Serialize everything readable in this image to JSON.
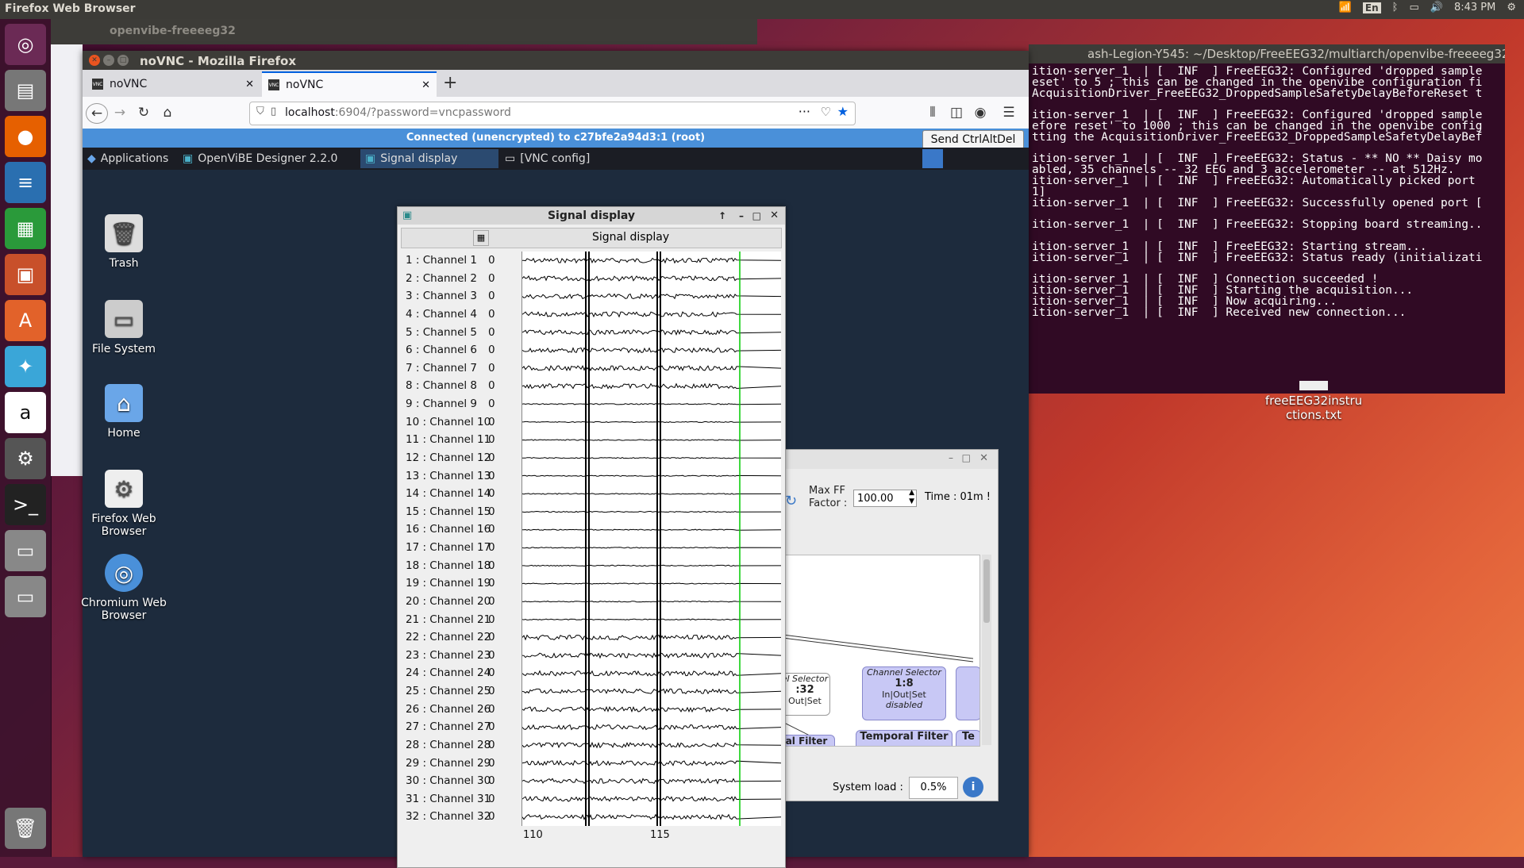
{
  "topbar": {
    "app_title": "Firefox Web Browser",
    "keyboard": "En",
    "time": "8:43 PM"
  },
  "bg_window": {
    "title": "openvibe-freeeeg32"
  },
  "firefox": {
    "title": "noVNC - Mozilla Firefox",
    "tabs": [
      {
        "label": "noVNC",
        "close": "✕"
      },
      {
        "label": "noVNC",
        "close": "✕"
      }
    ],
    "new_tab": "+",
    "url_host": "localhost",
    "url_rest": ":6904/?password=vncpassword",
    "dots": "···"
  },
  "vnc": {
    "status": "Connected (unencrypted) to c27bfe2a94d3:1 (root)",
    "send_cad": "Send CtrlAltDel",
    "panel": {
      "applications": "Applications",
      "tasks": [
        "OpenViBE Designer 2.2.0",
        "Signal display",
        "[VNC config]"
      ]
    },
    "desktop_icons": [
      {
        "label": "Trash",
        "icon": "trash-icon"
      },
      {
        "label": "File System",
        "icon": "drive-icon"
      },
      {
        "label": "Home",
        "icon": "home-folder-icon"
      },
      {
        "label": "Firefox Web Browser",
        "icon": "settings-icon"
      },
      {
        "label": "Chromium Web Browser",
        "icon": "chromium-icon"
      }
    ]
  },
  "signal_display": {
    "title": "Signal display",
    "toolbar_label": "Signal display",
    "channels": [
      "1 : Channel 1",
      "2 : Channel 2",
      "3 : Channel 3",
      "4 : Channel 4",
      "5 : Channel 5",
      "6 : Channel 6",
      "7 : Channel 7",
      "8 : Channel 8",
      "9 : Channel 9",
      "10 : Channel 10",
      "11 : Channel 11",
      "12 : Channel 12",
      "13 : Channel 13",
      "14 : Channel 14",
      "15 : Channel 15",
      "16 : Channel 16",
      "17 : Channel 17",
      "18 : Channel 18",
      "19 : Channel 19",
      "20 : Channel 20",
      "21 : Channel 21",
      "22 : Channel 22",
      "23 : Channel 23",
      "24 : Channel 24",
      "25 : Channel 25",
      "26 : Channel 26",
      "27 : Channel 27",
      "28 : Channel 28",
      "29 : Channel 29",
      "30 : Channel 30",
      "31 : Channel 31",
      "32 : Channel 32"
    ],
    "channel_value": "0",
    "x_ticks": [
      "110",
      "115"
    ]
  },
  "designer": {
    "max_ff_label": "Max FF",
    "factor_label": "Factor :",
    "factor_value": "100.00",
    "time_label": "Time : 01m !",
    "node1_title": "el Selector",
    "node1_value": ":32",
    "node1_ports": "Out|Set",
    "node2_title": "Channel Selector",
    "node2_value": "1:8",
    "node2_ports": "In|Out|Set",
    "node2_status": "disabled",
    "node3": "Temporal Filter",
    "node4": "Te",
    "node5": "al Filter",
    "sysload_label": "System load :",
    "sysload_value": "0.5%"
  },
  "terminal": {
    "title": "ash-Legion-Y545: ~/Desktop/FreeEEG32/multiarch/openvibe-freeeeg32",
    "lines": [
      "ition-server_1  | [  INF  ] FreeEEG32: Configured 'dropped sample",
      "eset' to 5 ; this can be changed in the openvibe configuration fi",
      "AcquisitionDriver_FreeEEG32_DroppedSampleSafetyDelayBeforeReset t",
      "",
      "ition-server_1  | [  INF  ] FreeEEG32: Configured 'dropped sample",
      "efore reset' to 1000 ; this can be changed in the openvibe config",
      "tting the AcquisitionDriver_FreeEEG32_DroppedSampleSafetyDelayBef",
      "",
      "ition-server_1  | [  INF  ] FreeEEG32: Status - ** NO ** Daisy mo",
      "abled, 35 channels -- 32 EEG and 3 accelerometer -- at 512Hz.",
      "ition-server_1  | [  INF  ] FreeEEG32: Automatically picked port",
      "1]",
      "ition-server_1  | [  INF  ] FreeEEG32: Successfully opened port [",
      "",
      "ition-server_1  | [  INF  ] FreeEEG32: Stopping board streaming..",
      "",
      "ition-server_1  | [  INF  ] FreeEEG32: Starting stream...",
      "ition-server_1  | [  INF  ] FreeEEG32: Status ready (initializati",
      "",
      "ition-server_1  | [  INF  ] Connection succeeded !",
      "ition-server_1  | [  INF  ] Starting the acquisition...",
      "ition-server_1  | [  INF  ] Now acquiring...",
      "ition-server_1  | [  INF  ] Received new connection..."
    ]
  },
  "desktop_file": {
    "label": "freeEEG32instructions.txt"
  },
  "colors": {
    "accent": "#0060df",
    "terminal_bg": "#300a24",
    "vnc_bar": "#4a90d9",
    "cursor_line": "#00cc00"
  }
}
